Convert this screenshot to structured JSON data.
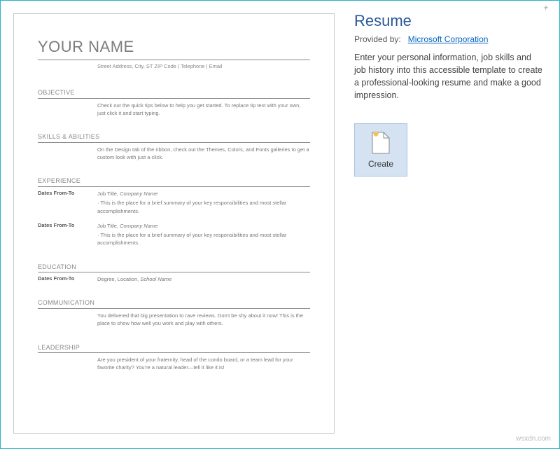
{
  "preview": {
    "name": "YOUR NAME",
    "contact": "Street Address, City, ST ZIP Code | Telephone | Email",
    "sections": {
      "objective": {
        "heading": "OBJECTIVE",
        "body": "Check out the quick tips below to help you get started. To replace tip text with your own, just click it and start typing."
      },
      "skills": {
        "heading": "SKILLS & ABILITIES",
        "body": "On the Design tab of the ribbon, check out the Themes, Colors, and Fonts galleries to get a custom look with just a click."
      },
      "experience": {
        "heading": "EXPERIENCE",
        "entries": [
          {
            "dates": "Dates From-To",
            "title": "Job Title,",
            "company": "Company Name",
            "bullet": "· This is the place for a brief summary of your key responsibilities and most stellar accomplishments."
          },
          {
            "dates": "Dates From-To",
            "title": "Job Title,",
            "company": "Company Name",
            "bullet": "· This is the place for a brief summary of your key responsibilities and most stellar accomplishments."
          }
        ]
      },
      "education": {
        "heading": "EDUCATION",
        "entry": {
          "dates": "Dates From-To",
          "degree": "Degree,",
          "location": "Location,",
          "school": "School Name"
        }
      },
      "communication": {
        "heading": "COMMUNICATION",
        "body": "You delivered that big presentation to rave reviews. Don't be shy about it now! This is the place to show how well you work and play with others."
      },
      "leadership": {
        "heading": "LEADERSHIP",
        "body": "Are you president of your fraternity, head of the condo board, or a team lead for your favorite charity? You're a natural leader—tell it like it is!"
      }
    }
  },
  "details": {
    "title": "Resume",
    "provided_label": "Provided by:",
    "provider": "Microsoft Corporation",
    "description": "Enter your personal information, job skills and job history into this accessible template to create a professional-looking resume and make a good impression.",
    "create_label": "Create"
  },
  "watermark": "wsxdn.com"
}
